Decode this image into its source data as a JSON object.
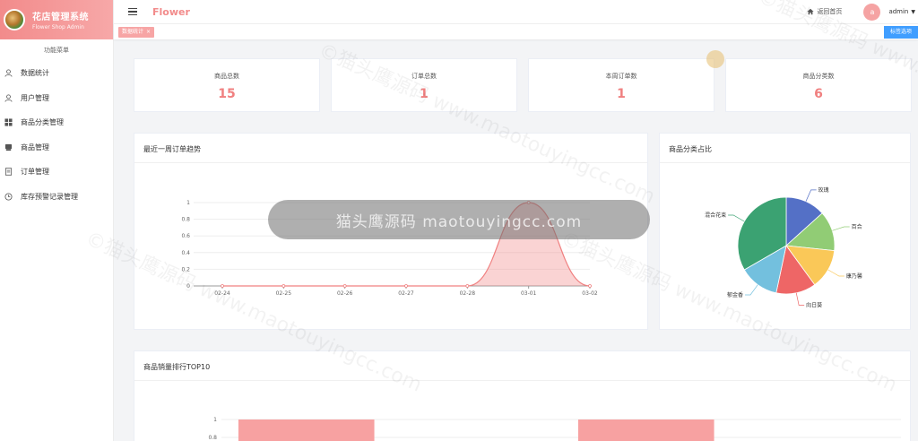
{
  "brand": {
    "title": "花店管理系统",
    "subtitle": "Flower Shop Admin"
  },
  "sidebar": {
    "header": "功能菜单",
    "items": [
      {
        "label": "数据统计",
        "icon": "user-icon"
      },
      {
        "label": "用户管理",
        "icon": "user-icon"
      },
      {
        "label": "商品分类管理",
        "icon": "grid-icon"
      },
      {
        "label": "商品管理",
        "icon": "box-icon"
      },
      {
        "label": "订单管理",
        "icon": "document-icon"
      },
      {
        "label": "库存预警记录管理",
        "icon": "clock-icon"
      }
    ]
  },
  "header": {
    "app_name": "Flower",
    "home_label": "返回首页",
    "avatar_letter": "a",
    "user_name": "admin"
  },
  "tags": {
    "active_tag": "数据统计",
    "close_button": "标签选项"
  },
  "stats": [
    {
      "label": "商品总数",
      "value": "15"
    },
    {
      "label": "订单总数",
      "value": "1"
    },
    {
      "label": "本周订单数",
      "value": "1"
    },
    {
      "label": "商品分类数",
      "value": "6"
    }
  ],
  "trend_panel": {
    "title": "最近一周订单趋势"
  },
  "pie_panel": {
    "title": "商品分类占比"
  },
  "top_panel": {
    "title": "商品销量排行TOP10"
  },
  "watermark": {
    "pill_text": "猫头鹰源码 maotouyingcc.com",
    "diagonal_text": "©猫头鹰源码 www.maotouyingcc.com"
  },
  "colors": {
    "accent": "#f08080",
    "brand": "#f7a8a8",
    "link": "#409eff"
  },
  "chart_data": [
    {
      "type": "line",
      "title": "最近一周订单趋势",
      "x": [
        "02-24",
        "02-25",
        "02-26",
        "02-27",
        "02-28",
        "03-01",
        "03-02"
      ],
      "series": [
        {
          "values": [
            0,
            0,
            0,
            0,
            0,
            1,
            0
          ]
        }
      ],
      "yticks": [
        "0",
        "0.2",
        "0.4",
        "0.6",
        "0.8",
        "1"
      ],
      "ylim": [
        0,
        1
      ],
      "smooth": true,
      "area": true,
      "color": "#f08080"
    },
    {
      "type": "pie",
      "title": "商品分类占比",
      "slices": [
        {
          "label": "玫瑰",
          "value": 2,
          "color": "#5470c6"
        },
        {
          "label": "百合",
          "value": 2,
          "color": "#91cc75"
        },
        {
          "label": "康乃馨",
          "value": 2,
          "color": "#fac858"
        },
        {
          "label": "向日葵",
          "value": 2,
          "color": "#ee6666"
        },
        {
          "label": "郁金香",
          "value": 2,
          "color": "#73c0de"
        },
        {
          "label": "混合花束",
          "value": 5,
          "color": "#3ba272"
        }
      ]
    },
    {
      "type": "bar",
      "title": "商品销量排行TOP10",
      "categories": [
        "",
        "",
        "",
        ""
      ],
      "values": [
        1,
        1
      ],
      "yticks_visible": [
        "1",
        "0.8"
      ],
      "color": "#f7a1a1"
    }
  ]
}
